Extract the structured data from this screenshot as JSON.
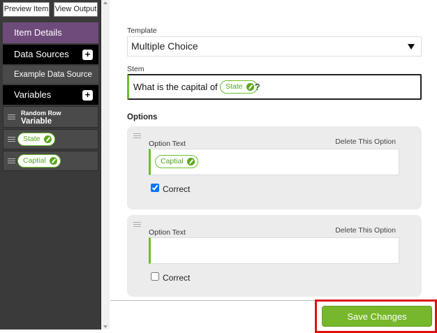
{
  "sidebar": {
    "preview_label": "Preview Item",
    "output_label": "View Output",
    "item_details": "Item Details",
    "data_sources": "Data Sources",
    "example_data_source": "Example Data Source",
    "variables": "Variables",
    "plus": "+",
    "random_row_small": "Random Row",
    "random_row_big": "Variable",
    "var_state": "State",
    "var_capital": "Captial"
  },
  "form": {
    "template_label": "Template",
    "template_value": "Multiple Choice",
    "stem_label": "Stem",
    "stem_text": "What is the capital of",
    "stem_pill": "State",
    "stem_suffix": "?",
    "options_heading": "Options",
    "options": [
      {
        "label": "Option Text",
        "delete": "Delete This Option",
        "pill": "Captial",
        "correct_label": "Correct",
        "correct": true
      },
      {
        "label": "Option Text",
        "delete": "Delete This Option",
        "pill": "",
        "correct_label": "Correct",
        "correct": false
      }
    ],
    "save_label": "Save Changes"
  },
  "colors": {
    "accent_green": "#77b72b",
    "sidebar_purple": "#6e4b7a",
    "highlight_red": "#e01010"
  }
}
